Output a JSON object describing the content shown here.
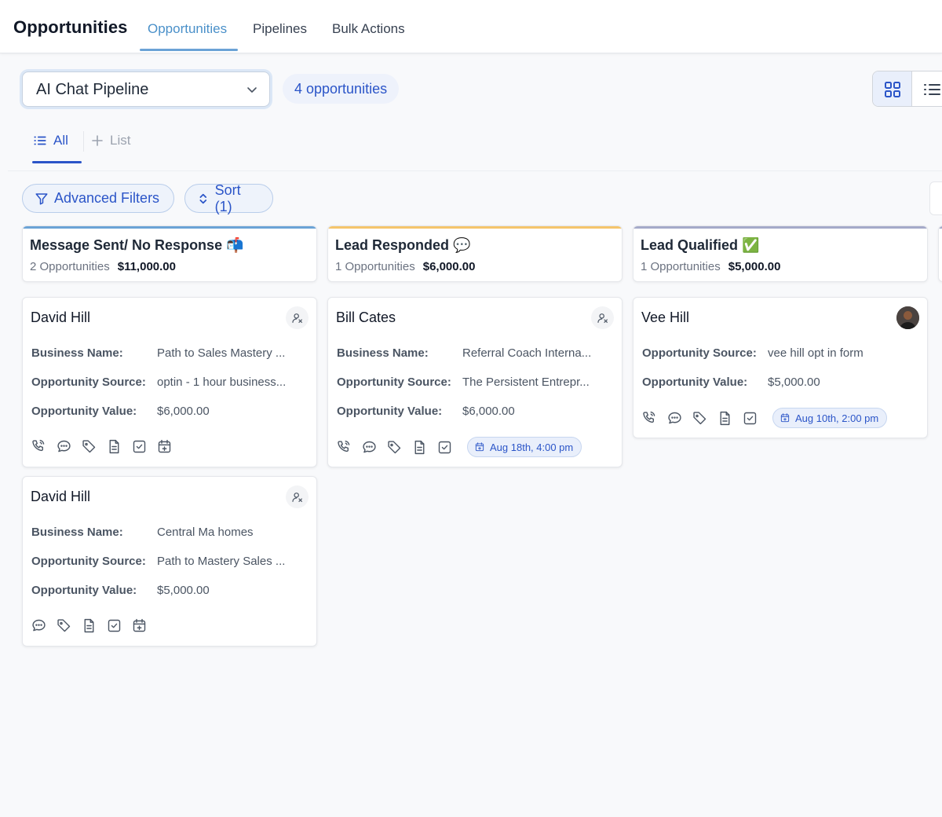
{
  "header": {
    "title": "Opportunities",
    "tabs": [
      {
        "label": "Opportunities",
        "active": true
      },
      {
        "label": "Pipelines",
        "active": false
      },
      {
        "label": "Bulk Actions",
        "active": false
      }
    ]
  },
  "toolbar": {
    "pipeline": "AI Chat Pipeline",
    "count_label": "4 opportunities",
    "view_modes": [
      "grid-icon",
      "list-icon"
    ]
  },
  "subtabs": {
    "all": "All",
    "add_list": "List"
  },
  "filters": {
    "advanced": "Advanced Filters",
    "sort": "Sort (1)"
  },
  "colors": {
    "accent": "#2b55c8",
    "stage1": "#6ba3d6",
    "stage2": "#f5c56b",
    "stage3": "#a5aac9"
  },
  "columns": [
    {
      "name": "Message Sent/ No Response 📬",
      "count": "2 Opportunities",
      "value": "$11,000.00",
      "cards": [
        {
          "name": "David Hill",
          "fields": [
            {
              "label": "Business Name:",
              "value": "Path to Sales Mastery ..."
            },
            {
              "label": "Opportunity Source:",
              "value": "optin - 1 hour business..."
            },
            {
              "label": "Opportunity Value:",
              "value": "$6,000.00"
            }
          ],
          "actions": [
            "phone-icon",
            "message-icon",
            "tag-icon",
            "note-icon",
            "task-icon",
            "calendar-add-icon"
          ],
          "appointment": ""
        },
        {
          "name": "David Hill",
          "fields": [
            {
              "label": "Business Name:",
              "value": "Central Ma homes"
            },
            {
              "label": "Opportunity Source:",
              "value": "Path to Mastery Sales ..."
            },
            {
              "label": "Opportunity Value:",
              "value": "$5,000.00"
            }
          ],
          "actions": [
            "message-icon",
            "tag-icon",
            "note-icon",
            "task-icon",
            "calendar-add-icon"
          ],
          "appointment": ""
        }
      ]
    },
    {
      "name": "Lead Responded 💬",
      "count": "1 Opportunities",
      "value": "$6,000.00",
      "cards": [
        {
          "name": "Bill Cates",
          "fields": [
            {
              "label": "Business Name:",
              "value": "Referral Coach Interna..."
            },
            {
              "label": "Opportunity Source:",
              "value": "The Persistent Entrepr..."
            },
            {
              "label": "Opportunity Value:",
              "value": "$6,000.00"
            }
          ],
          "actions": [
            "phone-icon",
            "message-icon",
            "tag-icon",
            "note-icon",
            "task-icon"
          ],
          "appointment": "Aug 18th, 4:00 pm"
        }
      ]
    },
    {
      "name": "Lead Qualified ✅",
      "count": "1 Opportunities",
      "value": "$5,000.00",
      "cards": [
        {
          "name": "Vee Hill",
          "fields": [
            {
              "label": "Opportunity Source:",
              "value": "vee hill opt in form"
            },
            {
              "label": "Opportunity Value:",
              "value": "$5,000.00"
            }
          ],
          "actions": [
            "phone-icon",
            "message-icon",
            "tag-icon",
            "note-icon",
            "task-icon"
          ],
          "appointment": "Aug 10th, 2:00 pm"
        }
      ]
    }
  ]
}
